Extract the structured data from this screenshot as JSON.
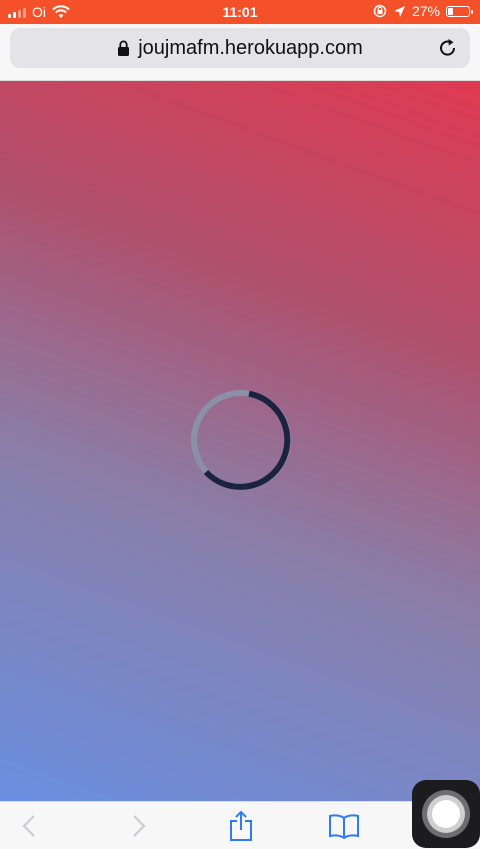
{
  "status_bar": {
    "carrier": "Oi",
    "time": "11:01",
    "battery_percent": "27%",
    "battery_level": 0.27,
    "background_color": "#f4502a",
    "icons": [
      "signal-icon",
      "wifi-icon",
      "orientation-lock-icon",
      "location-icon",
      "battery-icon"
    ]
  },
  "browser": {
    "url": "joujmafm.herokuapp.com",
    "icons": [
      "lock-icon",
      "reload-icon"
    ]
  },
  "page": {
    "gradient_colors": [
      "#e03a52",
      "#b04f6b",
      "#8a7ea8",
      "#6a8fe0"
    ],
    "loading_spinner": {
      "icon": "loading-spinner",
      "track_color": "#8a90a8",
      "arc_color": "#1b2340"
    }
  },
  "toolbar": {
    "icons": [
      "back-icon",
      "forward-icon",
      "share-icon",
      "bookmarks-icon",
      "tabs-icon"
    ]
  },
  "assistive_touch": {
    "icon": "assistive-touch-icon"
  }
}
